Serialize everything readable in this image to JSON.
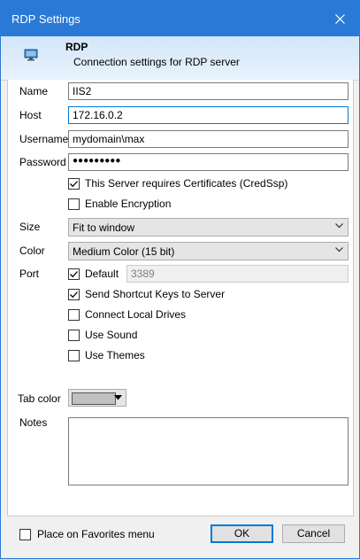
{
  "window": {
    "title": "RDP Settings"
  },
  "header": {
    "title": "RDP",
    "subtitle": "Connection settings for RDP server",
    "icon": "monitor-icon"
  },
  "form": {
    "name": {
      "label": "Name",
      "value": "IIS2"
    },
    "host": {
      "label": "Host",
      "value": "172.16.0.2"
    },
    "username": {
      "label": "Username",
      "value": "mydomain\\max"
    },
    "password": {
      "label": "Password",
      "value": "●●●●●●●●●"
    },
    "requires_certificates": {
      "label": "This Server requires Certificates (CredSsp)",
      "checked": true
    },
    "enable_encryption": {
      "label": "Enable Encryption",
      "checked": false
    },
    "size": {
      "label": "Size",
      "value": "Fit to window"
    },
    "color": {
      "label": "Color",
      "value": "Medium Color (15 bit)"
    },
    "port": {
      "label": "Port",
      "default_label": "Default",
      "default_checked": true,
      "value": "3389"
    },
    "send_shortcut_keys": {
      "label": "Send Shortcut Keys to Server",
      "checked": true
    },
    "connect_local_drives": {
      "label": "Connect Local Drives",
      "checked": false
    },
    "use_sound": {
      "label": "Use Sound",
      "checked": false
    },
    "use_themes": {
      "label": "Use Themes",
      "checked": false
    },
    "tab_color": {
      "label": "Tab color",
      "value": "#c0c0c0"
    },
    "notes": {
      "label": "Notes",
      "value": ""
    }
  },
  "footer": {
    "favorites": {
      "label": "Place on Favorites menu",
      "checked": false
    },
    "ok_label": "OK",
    "cancel_label": "Cancel"
  }
}
